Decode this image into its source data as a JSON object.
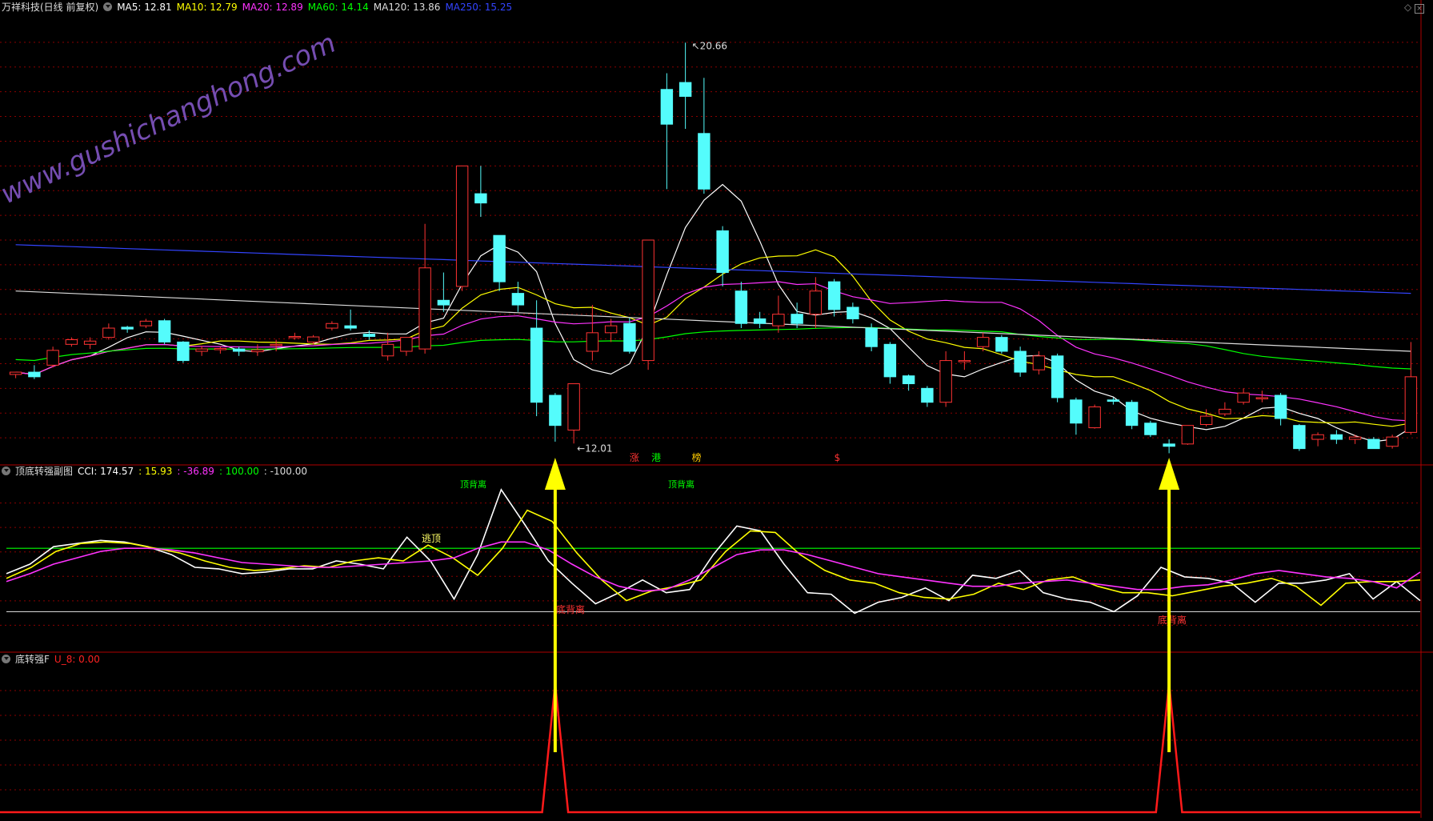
{
  "main_header": {
    "title": "万祥科技(日线 前复权)",
    "ma": [
      {
        "label": "MA5:",
        "value": "12.81",
        "color": "#ffffff"
      },
      {
        "label": "MA10:",
        "value": "12.79",
        "color": "#ffff00"
      },
      {
        "label": "MA20:",
        "value": "12.89",
        "color": "#ff33ff"
      },
      {
        "label": "MA60:",
        "value": "14.14",
        "color": "#00ff00"
      },
      {
        "label": "MA120:",
        "value": "13.86",
        "color": "#dddddd"
      },
      {
        "label": "MA250:",
        "value": "15.25",
        "color": "#3344ff"
      }
    ]
  },
  "watermark": "www.gushichanghong.com",
  "sub1_header": {
    "name": "顶底转强副图",
    "items": [
      {
        "text": "CCI: 174.57",
        "color": "#ffffff"
      },
      {
        "text": ": 15.93",
        "color": "#ffff00"
      },
      {
        "text": ": -36.89",
        "color": "#ff33ff"
      },
      {
        "text": ": 100.00",
        "color": "#00ff00"
      },
      {
        "text": ": -100.00",
        "color": "#dddddd"
      }
    ]
  },
  "sub2_header": {
    "name": "底转强F",
    "items": [
      {
        "text": "U_8: 0.00",
        "color": "#ff2222"
      }
    ]
  },
  "annotations": {
    "price_high": "20.66",
    "price_low": "12.01",
    "tags": [
      {
        "text": "涨",
        "color": "#ff3333"
      },
      {
        "text": "港",
        "color": "#00ff00"
      },
      {
        "text": "榜",
        "color": "#ffcc00"
      },
      {
        "text": "$",
        "color": "#ff3333"
      }
    ],
    "top_divergence_1": "顶背离",
    "top_divergence_2": "顶背离",
    "top_escape": "逃顶",
    "bottom_divergence_1": "底背离",
    "bottom_divergence_2": "底背离"
  },
  "colors": {
    "up": "#ff3333",
    "down": "#54fcfc",
    "ma5": "#ffffff",
    "ma10": "#ffff00",
    "ma20": "#ff33ff",
    "ma60": "#00ff00",
    "ma120": "#dddddd",
    "ma250": "#3344ff",
    "arrow": "#ffff00",
    "grid": "#8b0000"
  },
  "chart_data": [
    {
      "type": "candlestick",
      "title": "万祥科技(日线 前复权)",
      "ylim": [
        11.6,
        21.2
      ],
      "labels": {
        "high": 20.66,
        "low": 12.01
      },
      "candles": [
        [
          13.5,
          13.55,
          13.42,
          13.52
        ],
        [
          13.55,
          13.45,
          13.4,
          13.7
        ],
        [
          13.7,
          14.02,
          13.65,
          14.1
        ],
        [
          14.15,
          14.25,
          14.1,
          14.3
        ],
        [
          14.15,
          14.22,
          14.05,
          14.3
        ],
        [
          14.3,
          14.5,
          14.25,
          14.6
        ],
        [
          14.52,
          14.48,
          14.4,
          14.55
        ],
        [
          14.55,
          14.65,
          14.5,
          14.7
        ],
        [
          14.66,
          14.2,
          14.15,
          14.7
        ],
        [
          14.2,
          13.8,
          13.75,
          14.22
        ],
        [
          14.0,
          14.05,
          13.9,
          14.12
        ],
        [
          14.06,
          14.06,
          13.95,
          14.1
        ],
        [
          14.05,
          14.0,
          13.9,
          14.1
        ],
        [
          13.99,
          14.03,
          13.9,
          14.15
        ],
        [
          14.15,
          14.15,
          14.0,
          14.25
        ],
        [
          14.3,
          14.32,
          14.25,
          14.4
        ],
        [
          14.2,
          14.31,
          14.15,
          14.35
        ],
        [
          14.5,
          14.6,
          14.45,
          14.65
        ],
        [
          14.55,
          14.5,
          14.45,
          14.9
        ],
        [
          14.37,
          14.32,
          14.25,
          14.45
        ],
        [
          13.9,
          14.15,
          13.8,
          14.4
        ],
        [
          14.0,
          14.3,
          13.9,
          14.3
        ],
        [
          14.05,
          15.8,
          13.95,
          16.75
        ],
        [
          15.1,
          15.0,
          14.85,
          15.7
        ],
        [
          15.4,
          18.0,
          15.3,
          18.0
        ],
        [
          17.4,
          17.2,
          16.9,
          18.0
        ],
        [
          16.5,
          15.5,
          15.3,
          16.5
        ],
        [
          15.25,
          15.0,
          14.85,
          15.5
        ],
        [
          14.5,
          12.9,
          12.6,
          15.1
        ],
        [
          13.05,
          12.4,
          12.05,
          13.1
        ],
        [
          12.3,
          13.3,
          12.01,
          13.3
        ],
        [
          14.0,
          14.4,
          13.8,
          15.0
        ],
        [
          14.4,
          14.55,
          14.2,
          14.7
        ],
        [
          14.6,
          14.0,
          13.95,
          14.72
        ],
        [
          13.8,
          16.4,
          13.6,
          16.4
        ],
        [
          19.65,
          18.9,
          17.5,
          20.0
        ],
        [
          19.8,
          19.5,
          18.8,
          20.66
        ],
        [
          18.7,
          17.5,
          17.4,
          19.9
        ],
        [
          16.6,
          15.7,
          15.4,
          16.7
        ],
        [
          15.3,
          14.6,
          14.5,
          15.5
        ],
        [
          14.7,
          14.6,
          14.5,
          14.85
        ],
        [
          14.55,
          14.8,
          14.4,
          15.2
        ],
        [
          14.8,
          14.6,
          14.5,
          15.05
        ],
        [
          14.8,
          15.3,
          14.5,
          15.6
        ],
        [
          15.5,
          14.9,
          14.75,
          15.56
        ],
        [
          14.95,
          14.7,
          14.6,
          15.05
        ],
        [
          14.5,
          14.1,
          14.0,
          14.6
        ],
        [
          14.15,
          13.45,
          13.3,
          14.2
        ],
        [
          13.47,
          13.3,
          13.15,
          13.5
        ],
        [
          13.2,
          12.9,
          12.8,
          13.25
        ],
        [
          12.9,
          13.8,
          12.8,
          14.0
        ],
        [
          13.8,
          13.8,
          13.6,
          14.0
        ],
        [
          14.1,
          14.3,
          14.0,
          14.4
        ],
        [
          14.3,
          14.0,
          13.95,
          14.35
        ],
        [
          14.0,
          13.55,
          13.45,
          14.1
        ],
        [
          13.6,
          13.9,
          13.5,
          14.0
        ],
        [
          13.9,
          13.0,
          12.9,
          13.95
        ],
        [
          12.95,
          12.45,
          12.2,
          13.0
        ],
        [
          12.35,
          12.8,
          12.33,
          12.85
        ],
        [
          12.95,
          12.92,
          12.85,
          13.0
        ],
        [
          12.9,
          12.4,
          12.32,
          12.95
        ],
        [
          12.45,
          12.2,
          12.15,
          12.5
        ],
        [
          12.0,
          11.95,
          11.8,
          12.1
        ],
        [
          12.0,
          12.4,
          11.98,
          12.4
        ],
        [
          12.42,
          12.6,
          12.38,
          12.75
        ],
        [
          12.65,
          12.75,
          12.6,
          12.9
        ],
        [
          12.9,
          13.1,
          12.85,
          13.2
        ],
        [
          13.0,
          13.0,
          12.9,
          13.15
        ],
        [
          13.05,
          12.55,
          12.4,
          13.1
        ],
        [
          12.4,
          11.9,
          11.85,
          12.43
        ],
        [
          12.1,
          12.2,
          11.95,
          12.25
        ],
        [
          12.2,
          12.1,
          12.0,
          12.3
        ],
        [
          12.1,
          12.15,
          12.0,
          12.2
        ],
        [
          12.1,
          11.9,
          11.95,
          12.15
        ],
        [
          11.95,
          12.15,
          11.9,
          12.2
        ],
        [
          12.25,
          13.45,
          12.2,
          14.2
        ]
      ]
    },
    {
      "type": "line",
      "title": "顶底转强副图",
      "ylim": [
        -220,
        320
      ],
      "series": [
        {
          "name": "CCI",
          "values": [
            20,
            50,
            105,
            115,
            125,
            120,
            105,
            80,
            40,
            35,
            20,
            25,
            35,
            35,
            60,
            50,
            35,
            135,
            60,
            -60,
            80,
            285,
            175,
            60,
            -10,
            -75,
            -40,
            0,
            -40,
            -30,
            80,
            170,
            155,
            50,
            -40,
            -45,
            -105,
            -70,
            -55,
            -25,
            -65,
            15,
            5,
            30,
            -40,
            -60,
            -70,
            -100,
            -50,
            40,
            10,
            5,
            -10,
            -70,
            -10,
            -10,
            0,
            20,
            -60,
            -5,
            -65
          ]
        },
        {
          "name": "",
          "values": [
            5,
            40,
            90,
            115,
            120,
            115,
            100,
            85,
            60,
            40,
            30,
            35,
            45,
            40,
            60,
            70,
            60,
            110,
            70,
            15,
            100,
            220,
            185,
            85,
            0,
            -65,
            -35,
            -20,
            0,
            90,
            155,
            150,
            80,
            30,
            0,
            -10,
            -40,
            -55,
            -60,
            -45,
            -10,
            -30,
            0,
            10,
            -20,
            -40,
            -40,
            -50,
            -35,
            -20,
            -10,
            5,
            -20,
            -80,
            -10,
            -5,
            -5,
            0
          ]
        },
        {
          "name": "",
          "values": [
            -5,
            20,
            50,
            70,
            90,
            100,
            100,
            95,
            85,
            70,
            55,
            50,
            45,
            40,
            40,
            45,
            50,
            55,
            60,
            70,
            100,
            120,
            120,
            95,
            50,
            10,
            -20,
            -35,
            -30,
            0,
            40,
            80,
            95,
            95,
            80,
            60,
            40,
            20,
            10,
            0,
            -10,
            -20,
            -20,
            -10,
            -5,
            0,
            -10,
            -20,
            -30,
            -30,
            -20,
            -15,
            0,
            20,
            30,
            20,
            10,
            5,
            -5,
            -25,
            25
          ]
        }
      ]
    },
    {
      "type": "line",
      "title": "底转强F",
      "ylim": [
        0,
        1
      ],
      "series": [
        {
          "name": "U_8",
          "values": [
            0,
            0,
            0,
            0,
            0,
            0,
            0,
            0,
            0,
            0,
            0,
            0,
            0,
            0,
            0,
            0,
            0,
            0,
            0,
            0,
            0,
            0,
            0,
            0,
            0,
            0,
            0,
            0,
            0,
            1,
            0,
            0,
            0,
            0,
            0,
            0,
            0,
            0,
            0,
            0,
            0,
            0,
            0,
            0,
            0,
            0,
            0,
            0,
            0,
            0,
            0,
            0,
            0,
            0,
            0,
            0,
            0,
            0,
            0,
            0,
            0,
            0,
            1,
            0,
            0,
            0,
            0,
            0,
            0,
            0,
            0,
            0,
            0,
            0,
            0,
            0
          ]
        }
      ]
    }
  ]
}
